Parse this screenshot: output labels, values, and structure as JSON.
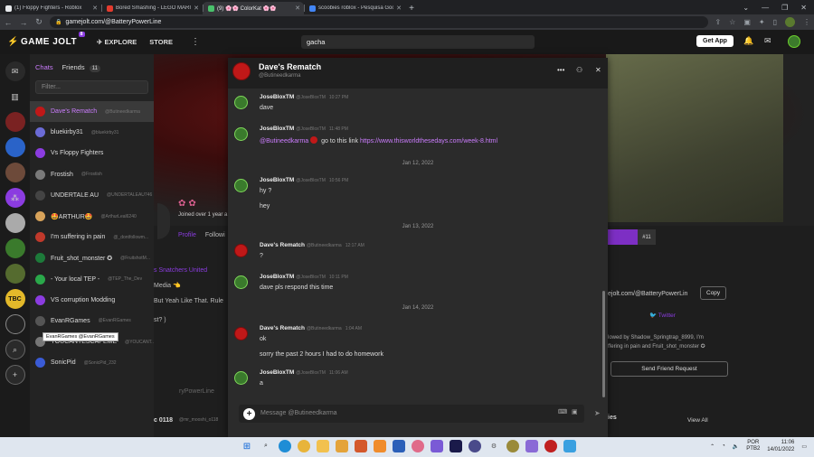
{
  "browser": {
    "tabs": [
      {
        "title": "(1) Floppy Fighters - Roblox",
        "color": "#e8eaed",
        "active": false
      },
      {
        "title": "Bored Smashing - LEGO MARIO",
        "color": "#e33b2e",
        "active": false
      },
      {
        "title": "(9) 🌸🌸 ColorKat 🌸🌸",
        "color": "#49c16b",
        "active": true
      },
      {
        "title": "scoobies roblox - Pesquisa Goo...",
        "color": "#4285f4",
        "active": false
      }
    ],
    "new_tab": "+",
    "url": "gamejolt.com/@BatteryPowerLine"
  },
  "gj": {
    "logo": "GAME JOLT",
    "logo_badge": "8",
    "explore": "EXPLORE",
    "store": "STORE",
    "search_value": "gacha",
    "get_app": "Get App"
  },
  "chatlist": {
    "tab_chats": "Chats",
    "tab_friends": "Friends",
    "friends_count": "11",
    "filter_placeholder": "Filter...",
    "items": [
      {
        "name": "Dave's Rematch",
        "user": "@Butineedkarma",
        "color": "#c01818"
      },
      {
        "name": "bluekirby31",
        "user": "@bluekirby31",
        "color": "#6b6bd6"
      },
      {
        "name": "Vs Floppy Fighters",
        "user": "",
        "color": "#8b3ce0"
      },
      {
        "name": "Frostish",
        "user": "@Frostish",
        "color": "#7a7a7a"
      },
      {
        "name": "UNDERTALE AU",
        "user": "@UNDERTALEAU746",
        "color": "#444"
      },
      {
        "name": "🤩ARTHUR🤩",
        "user": "@ArthurLeal6240",
        "color": "#d8a35a"
      },
      {
        "name": "I'm suffering in pain",
        "user": "@_dontfollowm...",
        "color": "#c0392b"
      },
      {
        "name": "Fruit_shot_monster ✪",
        "user": "@FruitshotM...",
        "color": "#1d7a3a"
      },
      {
        "name": "- Your local TEP -",
        "user": "@TEP_The_Dev",
        "color": "#2aa84a"
      },
      {
        "name": "VS corruption Modding",
        "user": "",
        "color": "#8b3ce0"
      },
      {
        "name": "EvanRGames",
        "user": "@EvanRGames",
        "color": "#555"
      },
      {
        "name": "YOUCANTESCAPEME",
        "user": "@YOUCANT...",
        "color": "#777"
      },
      {
        "name": "SonicPid",
        "user": "@SonicPid_232",
        "color": "#3a5bd6"
      }
    ],
    "tooltip": "EvanRGames @EvanRGames"
  },
  "profile": {
    "joined": "Joined over 1 year a",
    "tab_profile": "Profile",
    "tab_following": "Followi",
    "snatchers": "s Snatchers United",
    "media": "Media 👈",
    "yeah": "But Yeah Like That. Rule",
    "paren": "st? )",
    "url_copy": "ejolt.com/@BatteryPowerLin",
    "copy": "Copy",
    "twitter": "Twitter",
    "followed_by": "lowed by Shadow_Springtrap_8999, I'm",
    "followed_by2": "ffering in pain and Fruit_shot_monster ✪",
    "send_friend_request": "Send Friend Request",
    "rank": "#11",
    "ies": "ies",
    "view_all": "View All",
    "bottom_left": "c 0118",
    "bottom_left2": "ryPowerLine",
    "bottom_user": "@mr_mooshi_o118"
  },
  "chat": {
    "title": "Dave's Rematch",
    "subtitle": "@Butineedkarma",
    "composer_placeholder": "Message @Butineedkarma",
    "messages": [
      {
        "kind": "msg",
        "author": "JoseBloxTM",
        "handle": "@JoseBloxTM",
        "time": "10:27 PM",
        "text": "dave"
      },
      {
        "kind": "msg",
        "author": "JoseBloxTM",
        "handle": "@JoseBloxTM",
        "time": "11:48 PM",
        "mention": "@Butineedkarma",
        "text": " go to this link ",
        "link": "https://www.thisworldthesedays.com/week-8.html"
      },
      {
        "kind": "date",
        "text": "Jan 12, 2022"
      },
      {
        "kind": "msg",
        "author": "JoseBloxTM",
        "handle": "@JoseBloxTM",
        "time": "10:56 PM",
        "text": "hy ?",
        "text2": "hey"
      },
      {
        "kind": "date",
        "text": "Jan 13, 2022"
      },
      {
        "kind": "msg",
        "author": "Dave's Rematch",
        "handle": "@Butineedkarma",
        "time": "12:17 AM",
        "text": "?"
      },
      {
        "kind": "msg",
        "author": "JoseBloxTM",
        "handle": "@JoseBloxTM",
        "time": "10:11 PM",
        "text": "dave pls respond this time"
      },
      {
        "kind": "date",
        "text": "Jan 14, 2022"
      },
      {
        "kind": "msg",
        "author": "Dave's Rematch",
        "handle": "@Butineedkarma",
        "time": "1:04 AM",
        "text": "ok",
        "text2": "sorry the past 2 hours I had to do homework"
      },
      {
        "kind": "msg",
        "author": "JoseBloxTM",
        "handle": "@JoseBloxTM",
        "time": "11:06 AM",
        "text": "a"
      }
    ]
  },
  "taskbar": {
    "lang": "POR",
    "lang2": "PTB2",
    "time": "11:06",
    "date": "14/01/2022"
  }
}
